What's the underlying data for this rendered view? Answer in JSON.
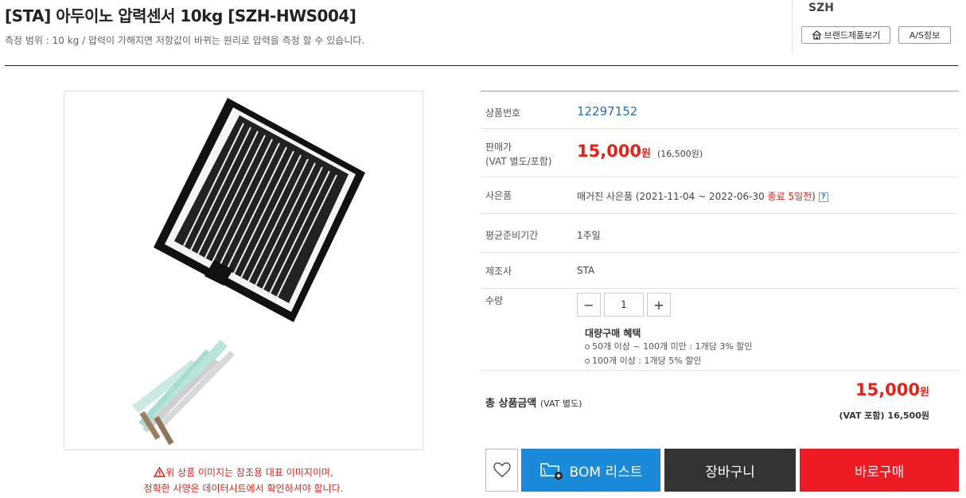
{
  "product": {
    "title": "[STA] 아두이노 압력센서 10kg [SZH-HWS004]",
    "subtitle": "측정 범위 : 10 kg / 압력이 가해지면 저항값이 바뀌는 원리로 압력을 측정 할 수 있습니다."
  },
  "brand": {
    "name": "SZH",
    "brand_products_label": "브랜드제품보기",
    "as_info_label": "A/S정보"
  },
  "image_notice": {
    "line1": "위 상품 이미지는 참조용 대표 이미지이며,",
    "line2": "정확한 사양은 데이터시트에서 확인하셔야 합니다."
  },
  "info": {
    "code_label": "상품번호",
    "code_value": "12297152",
    "price_label_1": "판매가",
    "price_label_2": "(VAT 별도/포함)",
    "price": "15,000",
    "price_unit": "원",
    "price_vat": "(16,500원)",
    "gift_label": "사은품",
    "gift_text": "매거진 사은품 (2021-11-04 ~ 2022-06-30",
    "gift_end": "종료 5일전",
    "gift_close": ")",
    "gift_help": "?",
    "lead_label": "평균준비기간",
    "lead_value": "1주일",
    "maker_label": "제조사",
    "maker_value": "STA",
    "qty_label": "수량",
    "qty_minus": "−",
    "qty_value": "1",
    "qty_plus": "+",
    "bulk_title": "대량구매 혜택",
    "bulk_items": [
      "50개 이상 ~ 100개 미만 : 1개당 3% 할인",
      "100개 이상 : 1개당 5% 할인"
    ]
  },
  "total": {
    "label": "총 상품금액",
    "label_vat": "(VAT 별도)",
    "price": "15,000",
    "unit": "원",
    "vat_label": "(VAT 포함)",
    "vat_price": "16,500원"
  },
  "actions": {
    "wish_icon": "heart-icon",
    "bom_label": "BOM 리스트",
    "cart_label": "장바구니",
    "buy_label": "바로구매"
  },
  "colors": {
    "accent_red": "#e2231a",
    "bom_blue": "#1b8ad8",
    "cart_dark": "#333333",
    "buy_red": "#ed1c24"
  }
}
